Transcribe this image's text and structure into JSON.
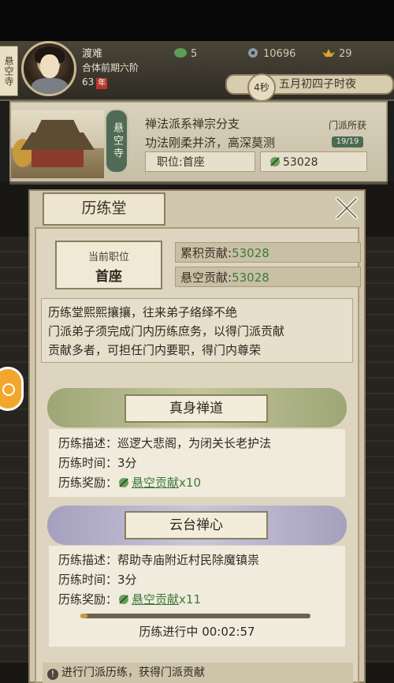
{
  "header": {
    "sect_tab": "悬空寺",
    "name": "渡难",
    "realm": "合体前期六阶",
    "level": "63",
    "level_tag": "年",
    "resources": {
      "jade": "5",
      "coin": "10696",
      "gold": "29"
    },
    "time_countdown": "4秒",
    "date": "五月初四子时夜"
  },
  "sect": {
    "temple_label": "悬空寺",
    "line1": "禅法派系禅宗分支",
    "line2": "功法刚柔并济，高深莫测",
    "position_field": "职位:首座",
    "contribution_field": "53028",
    "badge_title": "门派所获",
    "badge_count": "19/19"
  },
  "dialog": {
    "title": "历练堂",
    "rank_label": "当前职位",
    "rank_value": "首座",
    "stat1_label": "累积贡献:",
    "stat1_value": "53028",
    "stat2_label": "悬空贡献:",
    "stat2_value": "53028",
    "desc_lines": [
      "历练堂熙熙攘攘，往来弟子络绎不绝",
      "门派弟子须完成门内历练庶务，以得门派贡献",
      "贡献多者，可担任门内要职，得门内尊荣"
    ],
    "tasks": [
      {
        "title": "真身禅道",
        "desc": "历练描述：巡逻大悲阁，为闭关长老护法",
        "time": "历练时间：3分",
        "reward_label": "历练奖励：",
        "reward_name": "悬空贡献",
        "reward_mult": "x10"
      },
      {
        "title": "云台禅心",
        "desc": "历练描述：帮助寺庙附近村民除魔镇祟",
        "time": "历练时间：3分",
        "reward_label": "历练奖励：",
        "reward_name": "悬空贡献",
        "reward_mult": "x11"
      }
    ],
    "progress_text": "历练进行中  00:02:57",
    "progress": 0.03,
    "tip": "进行门派历练，获得门派贡献"
  }
}
